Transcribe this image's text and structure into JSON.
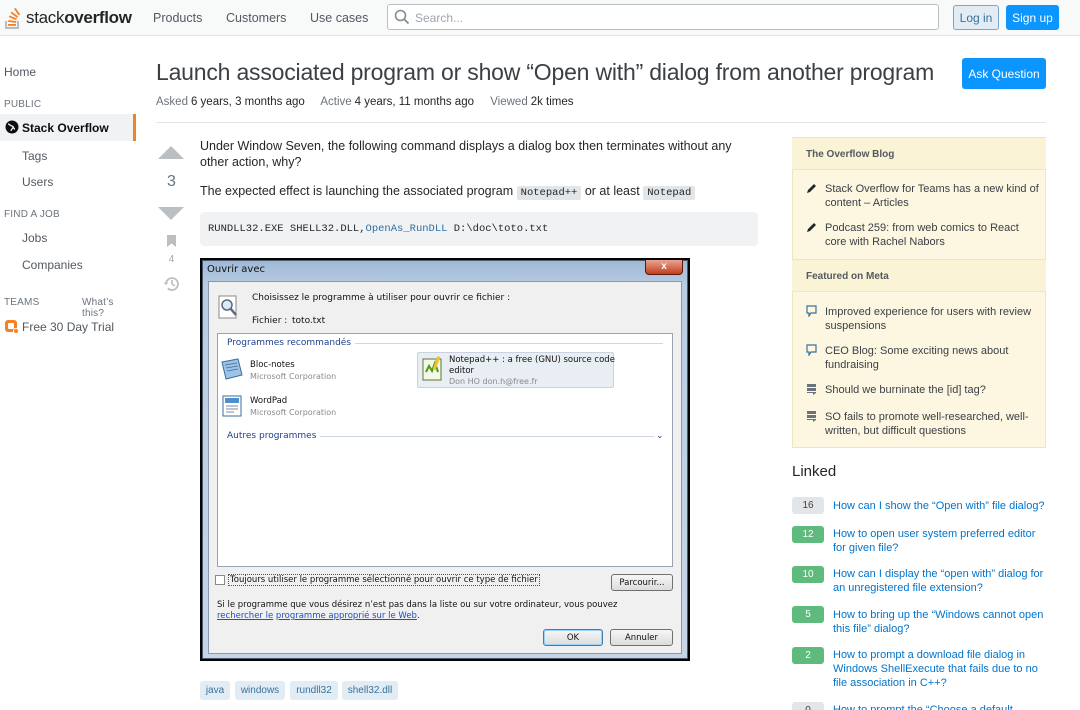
{
  "header": {
    "logo_light": "stack",
    "logo_bold": "overflow",
    "nav": [
      "Products",
      "Customers",
      "Use cases"
    ],
    "search_placeholder": "Search...",
    "login": "Log in",
    "signup": "Sign up"
  },
  "sidebar": {
    "home": "Home",
    "public": "PUBLIC",
    "stackoverflow": "Stack Overflow",
    "tags": "Tags",
    "users": "Users",
    "find_job": "FIND A JOB",
    "jobs": "Jobs",
    "companies": "Companies",
    "teams": "TEAMS",
    "whats_this": "What’s this?",
    "trial": "Free 30 Day Trial"
  },
  "question": {
    "title": "Launch associated program or show “Open with” dialog from another program",
    "ask_button": "Ask Question",
    "asked_label": "Asked",
    "asked_value": "6 years, 3 months ago",
    "active_label": "Active",
    "active_value": "4 years, 11 months ago",
    "viewed_label": "Viewed",
    "viewed_value": "2k times",
    "votes": "3",
    "bookmarks": "4",
    "p1": "Under Window Seven, the following command displays a dialog box then terminates without any other action, why?",
    "p2_a": "The expected effect is launching the associated program",
    "p2_code1": "Notepad++",
    "p2_b": "or at least",
    "p2_code2": "Notepad",
    "code_a": "RUNDLL32.EXE SHELL32.DLL,",
    "code_fn": "OpenAs_RunDLL",
    "code_b": " D:\\doc\\toto.txt",
    "tags": [
      "java",
      "windows",
      "rundll32",
      "shell32.dll"
    ]
  },
  "dialog": {
    "title": "Ouvrir avec",
    "close": "x",
    "prompt": "Choisissez le programme à utiliser pour ouvrir ce fichier :",
    "file_label": "Fichier :",
    "file_value": "toto.txt",
    "recommended": "Programmes recommandés",
    "prog1_name": "Bloc-notes",
    "prog1_sub": "Microsoft Corporation",
    "prog2_name": "WordPad",
    "prog2_sub": "Microsoft Corporation",
    "prog3_name_1": "Notepad++ : a free (GNU) source code",
    "prog3_name_2": "editor",
    "prog3_sub": "Don HO don.h@free.fr",
    "other": "Autres programmes",
    "always": "Toujours utiliser le programme sélectionné pour ouvrir ce type de fichier",
    "browse": "Parcourir...",
    "foot_a": "Si le programme que vous désirez n’est pas dans la liste ou sur votre ordinateur, vous pouvez",
    "foot_link_1": "rechercher le",
    "foot_link_2": "programme approprié sur le Web",
    "foot_end": ".",
    "ok": "OK",
    "cancel": "Annuler"
  },
  "blog": {
    "header1": "The Overflow Blog",
    "item1": "Stack Overflow for Teams has a new kind of content – Articles",
    "item2": "Podcast 259: from web comics to React core with Rachel Nabors",
    "header2": "Featured on Meta",
    "item3": "Improved experience for users with review suspensions",
    "item4": "CEO Blog: Some exciting news about fundraising",
    "item5": "Should we burninate the [id] tag?",
    "item6": "SO fails to promote well-researched, well-written, but difficult questions"
  },
  "linked": {
    "title": "Linked",
    "items": [
      {
        "count": "16",
        "text": "How can I show the “Open with” file dialog?"
      },
      {
        "count": "12",
        "text": "How to open user system preferred editor for given file?"
      },
      {
        "count": "10",
        "text": "How can I display the “open with” dialog for an unregistered file extension?"
      },
      {
        "count": "5",
        "text": "How to bring up the “Windows cannot open this file” dialog?"
      },
      {
        "count": "2",
        "text": "How to prompt a download file dialog in Windows ShellExecute that fails due to no file association in C++?"
      },
      {
        "count": "0",
        "text": "How to prompt the “Choose a default"
      }
    ]
  }
}
